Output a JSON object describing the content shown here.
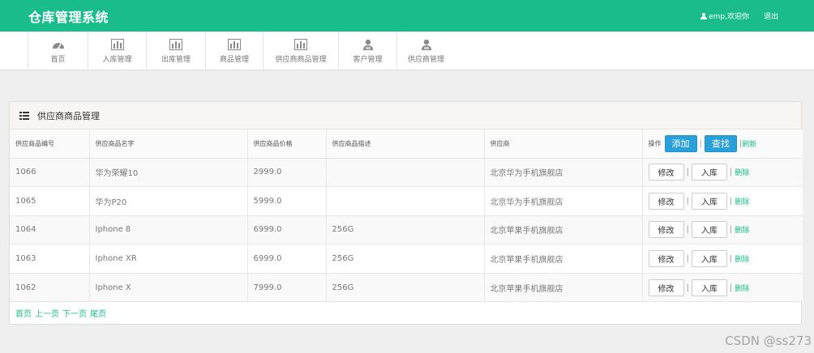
{
  "header": {
    "title": "仓库管理系统",
    "user_text": "emp,欢迎你",
    "logout": "退出"
  },
  "nav": {
    "items": [
      {
        "label": "首页",
        "icon": "dashboard-icon"
      },
      {
        "label": "入库管理",
        "icon": "bar-chart-icon"
      },
      {
        "label": "出库管理",
        "icon": "bar-chart-icon"
      },
      {
        "label": "商品管理",
        "icon": "bar-chart-icon"
      },
      {
        "label": "供应商商品管理",
        "icon": "bar-chart-icon"
      },
      {
        "label": "客户管理",
        "icon": "users-icon"
      },
      {
        "label": "供应商管理",
        "icon": "users-icon"
      }
    ]
  },
  "panel": {
    "title": "供应商商品管理",
    "columns": [
      "供应商品编号",
      "供应商品名字",
      "供应商品价格",
      "供应商品描述",
      "供应商"
    ],
    "op_label": "操作",
    "add_label": "添加",
    "search_label": "查找",
    "refresh_label": "刷新",
    "sep": "|",
    "rows": [
      {
        "id": "1066",
        "name": "华为荣耀10",
        "price": "2999.0",
        "desc": "",
        "supplier": "北京华为手机旗舰店"
      },
      {
        "id": "1065",
        "name": "华为P20",
        "price": "5999.0",
        "desc": "",
        "supplier": "北京华为手机旗舰店"
      },
      {
        "id": "1064",
        "name": "Iphone 8",
        "price": "6999.0",
        "desc": "256G",
        "supplier": "北京苹果手机旗舰店"
      },
      {
        "id": "1063",
        "name": "Iphone XR",
        "price": "6999.0",
        "desc": "256G",
        "supplier": "北京苹果手机旗舰店"
      },
      {
        "id": "1062",
        "name": "Iphone X",
        "price": "7999.0",
        "desc": "256G",
        "supplier": "北京苹果手机旗舰店"
      }
    ],
    "row_actions": {
      "edit": "修改",
      "stock_in": "入库",
      "delete": "删除"
    }
  },
  "pager": {
    "first": "首页",
    "prev": "上一页",
    "next": "下一页",
    "last": "尾页"
  },
  "watermark": "CSDN @ss273",
  "colors": {
    "brand": "#1abc8c",
    "primary_button": "#2a9fd8"
  }
}
